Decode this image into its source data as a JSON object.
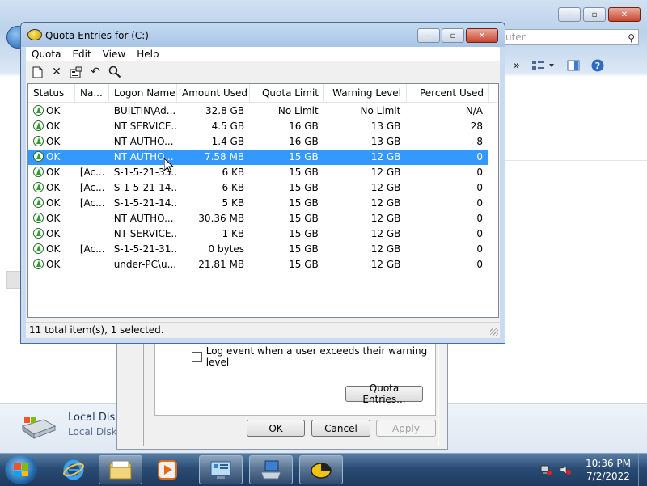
{
  "background_explorer": {
    "search_placeholder": "uter",
    "toolbar_more": "»",
    "details": {
      "title": "Local Disk",
      "subtitle": "Local Disk"
    }
  },
  "props_dialog": {
    "log_checkbox_label": "Log event when a user exceeds their warning level",
    "quota_entries_button": "Quota Entries...",
    "ok": "OK",
    "cancel": "Cancel",
    "apply": "Apply"
  },
  "quota_window": {
    "title": "Quota Entries for  (C:)",
    "menu": [
      "Quota",
      "Edit",
      "View",
      "Help"
    ],
    "columns": [
      "Status",
      "Na...",
      "Logon Name",
      "Amount Used",
      "Quota Limit",
      "Warning Level",
      "Percent Used"
    ],
    "rows": [
      {
        "status": "OK",
        "name": "",
        "logon": "BUILTIN\\Ad...",
        "used": "32.8 GB",
        "limit": "No Limit",
        "warn": "No Limit",
        "pct": "N/A"
      },
      {
        "status": "OK",
        "name": "",
        "logon": "NT SERVICE...",
        "used": "4.5 GB",
        "limit": "16 GB",
        "warn": "13 GB",
        "pct": "28"
      },
      {
        "status": "OK",
        "name": "",
        "logon": "NT AUTHO...",
        "used": "1.4 GB",
        "limit": "16 GB",
        "warn": "13 GB",
        "pct": "8"
      },
      {
        "status": "OK",
        "name": "",
        "logon": "NT AUTHO...",
        "used": "7.58 MB",
        "limit": "15 GB",
        "warn": "12 GB",
        "pct": "0"
      },
      {
        "status": "OK",
        "name": "[Ac...",
        "logon": "S-1-5-21-33...",
        "used": "6 KB",
        "limit": "15 GB",
        "warn": "12 GB",
        "pct": "0"
      },
      {
        "status": "OK",
        "name": "[Ac...",
        "logon": "S-1-5-21-14...",
        "used": "6 KB",
        "limit": "15 GB",
        "warn": "12 GB",
        "pct": "0"
      },
      {
        "status": "OK",
        "name": "[Ac...",
        "logon": "S-1-5-21-14...",
        "used": "5 KB",
        "limit": "15 GB",
        "warn": "12 GB",
        "pct": "0"
      },
      {
        "status": "OK",
        "name": "",
        "logon": "NT AUTHO...",
        "used": "30.36 MB",
        "limit": "15 GB",
        "warn": "12 GB",
        "pct": "0"
      },
      {
        "status": "OK",
        "name": "",
        "logon": "NT SERVICE...",
        "used": "1 KB",
        "limit": "15 GB",
        "warn": "12 GB",
        "pct": "0"
      },
      {
        "status": "OK",
        "name": "[Ac...",
        "logon": "S-1-5-21-31...",
        "used": "0 bytes",
        "limit": "15 GB",
        "warn": "12 GB",
        "pct": "0"
      },
      {
        "status": "OK",
        "name": "",
        "logon": "under-PC\\u...",
        "used": "21.81 MB",
        "limit": "15 GB",
        "warn": "12 GB",
        "pct": "0"
      }
    ],
    "selected_row": 3,
    "status_text": "11 total item(s), 1 selected."
  },
  "taskbar": {
    "time": "10:36 PM",
    "date": "7/2/2022"
  },
  "icons": {
    "status_ok": "status-ok-icon",
    "new": "new-quota-entry-icon",
    "delete": "delete-icon",
    "properties": "properties-icon",
    "undo": "undo-icon",
    "find": "find-icon"
  }
}
